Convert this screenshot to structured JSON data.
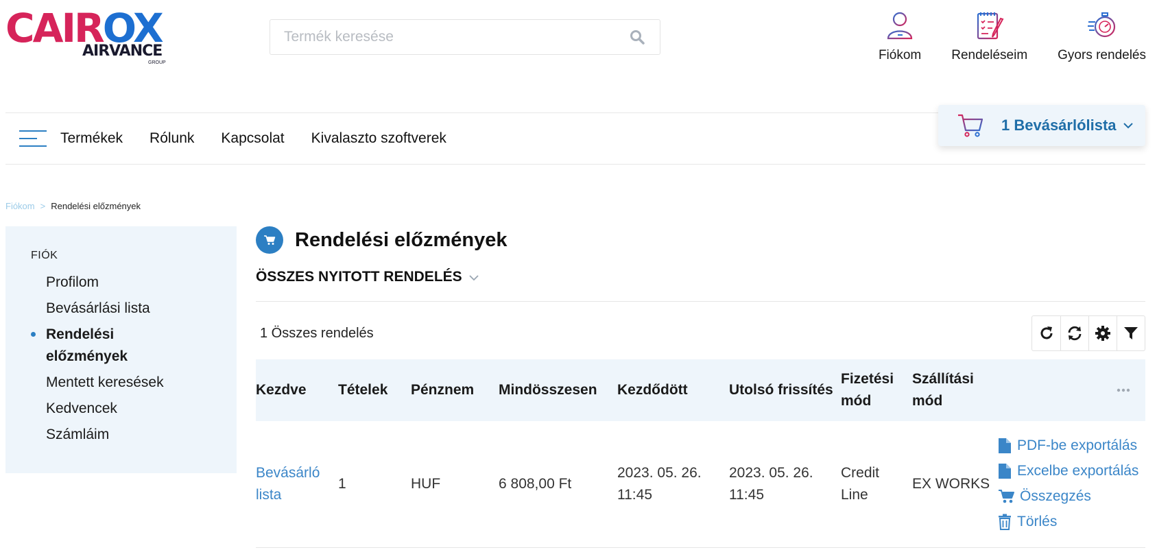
{
  "brand": {
    "name_part1": "CAIR",
    "name_part2": "O",
    "name_part3": "X",
    "sub": "AIRVANCE",
    "group": "GROUP",
    "colors": {
      "red": "#d6245a",
      "blue": "#1d6fd1",
      "accent": "#2c7fc3"
    }
  },
  "search": {
    "placeholder": "Termék keresése",
    "value": "",
    "icon": "search-icon"
  },
  "top_actions": [
    {
      "label": "Fiókom",
      "icon": "user-icon"
    },
    {
      "label": "Rendeléseim",
      "icon": "orders-clipboard-icon"
    },
    {
      "label": "Gyors rendelés",
      "icon": "stopwatch-icon"
    }
  ],
  "nav": {
    "menu_icon": "hamburger-icon",
    "links": [
      "Termékek",
      "Rólunk",
      "Kapcsolat",
      "Kivalaszto szoftverek"
    ]
  },
  "cart": {
    "label": "1 Bevásárlólista",
    "icon": "cart-icon"
  },
  "breadcrumb": {
    "parent": "Fiókom",
    "separator": ">",
    "current": "Rendelési előzmények"
  },
  "sidebar": {
    "heading": "FIÓK",
    "items": [
      {
        "label": "Profilom",
        "active": false
      },
      {
        "label": "Bevásárlási lista",
        "active": false
      },
      {
        "label": "Rendelési előzmények",
        "active": true
      },
      {
        "label": "Mentett keresések",
        "active": false
      },
      {
        "label": "Kedvencek",
        "active": false
      },
      {
        "label": "Számláim",
        "active": false
      }
    ]
  },
  "main": {
    "title": "Rendelési előzmények",
    "section_title": "ÖSSZES NYITOTT RENDELÉS",
    "order_count": "1 Összes rendelés",
    "toolbar": [
      "refresh-icon",
      "sync-icon",
      "settings-gear-icon",
      "filter-icon"
    ],
    "table": {
      "headers": [
        "Kezdve",
        "Tételek",
        "Pénznem",
        "Mindösszesen",
        "Kezdődött",
        "Utolsó frissítés",
        "Fizetési mód",
        "Szállítási mód"
      ],
      "rows": [
        {
          "kezdve": "Bevásárló lista",
          "tetelek": "1",
          "penznem": "HUF",
          "mindosszesen": "6 808,00 Ft",
          "kezdodott": "2023. 05. 26. 11:45",
          "utolso_frissites": "2023. 05. 26. 11:45",
          "fizetesi_mod": "Credit Line",
          "szallitasi_mod": "EX WORKS",
          "actions": [
            "PDF-be exportálás",
            "Excelbe exportálás",
            "Összegzés",
            "Törlés"
          ]
        }
      ]
    }
  }
}
